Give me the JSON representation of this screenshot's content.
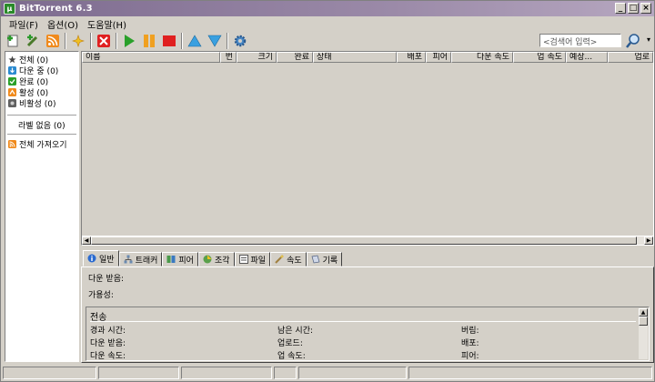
{
  "window": {
    "title": "BitTorrent 6.3"
  },
  "menu": {
    "items": [
      "파일(F)",
      "옵션(O)",
      "도움말(H)"
    ]
  },
  "toolbar": {
    "buttons": [
      "add-torrent",
      "add-torrent-url",
      "rss",
      "create-torrent",
      "remove",
      "start",
      "pause",
      "stop",
      "move-up",
      "move-down",
      "preferences"
    ],
    "search_placeholder": "<검색어 입력>"
  },
  "sidebar": {
    "items": [
      {
        "label": "전체 (0)",
        "icon": "all-icon"
      },
      {
        "label": "다운 중 (0)",
        "icon": "downloading-icon"
      },
      {
        "label": "완료 (0)",
        "icon": "completed-icon"
      },
      {
        "label": "활성 (0)",
        "icon": "active-icon"
      },
      {
        "label": "비활성 (0)",
        "icon": "inactive-icon"
      }
    ],
    "labels_item": "라벨 없음 (0)",
    "feeds_item": "전체 가져오기"
  },
  "list": {
    "columns": [
      "이름",
      "번",
      "크기",
      "완료",
      "상태",
      "배포",
      "피어",
      "다운 속도",
      "업 속도",
      "예상...",
      "업로"
    ]
  },
  "tabs": [
    "일반",
    "트래커",
    "피어",
    "조각",
    "파일",
    "속도",
    "기록"
  ],
  "general": {
    "downloaded_label": "다운 받음:",
    "availability_label": "가용성:",
    "transfer_title": "전송",
    "transfer": {
      "col1": [
        "경과 시간:",
        "다운 받음:",
        "다운 속도:"
      ],
      "col2": [
        "남은 시간:",
        "업로드:",
        "업 속도:"
      ],
      "col3": [
        "버림:",
        "배포:",
        "피어:"
      ]
    }
  },
  "colors": {
    "titlebar": "#7d6b8f",
    "window_bg": "#d4d0c8"
  }
}
